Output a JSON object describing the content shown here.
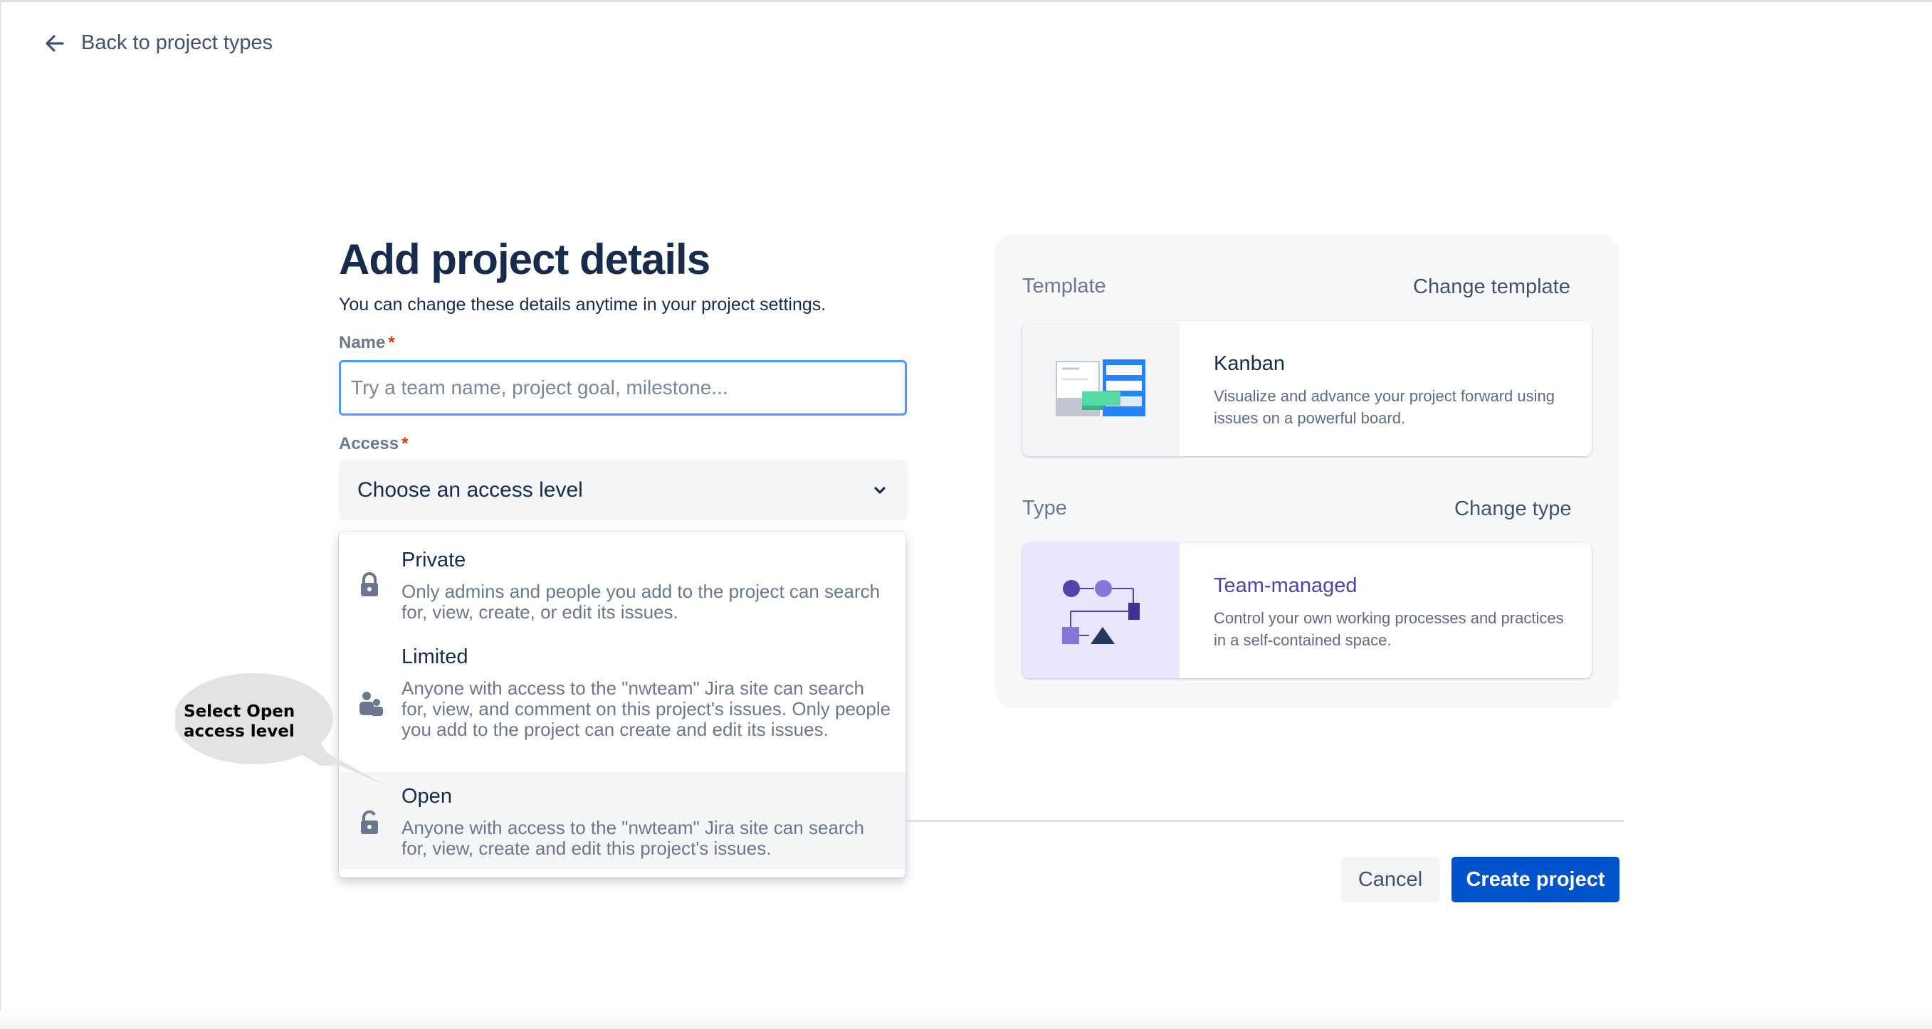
{
  "nav": {
    "back_label": "Back to project types"
  },
  "header": {
    "title": "Add project details",
    "subtitle": "You can change these details anytime in your project settings."
  },
  "form": {
    "name": {
      "label": "Name",
      "required_mark": "*",
      "value": "",
      "placeholder": "Try a team name, project goal, milestone..."
    },
    "access": {
      "label": "Access",
      "required_mark": "*",
      "selected_text": "Choose an access level",
      "options": [
        {
          "title": "Private",
          "description": "Only admins and people you add to the project can search for, view, create, or edit its issues.",
          "icon": "lock-icon"
        },
        {
          "title": "Limited",
          "description": "Anyone with access to the \"nwteam\" Jira site can search for, view, and comment on this project's issues. Only people you add to the project can create and edit its issues.",
          "icon": "people-icon"
        },
        {
          "title": "Open",
          "description": "Anyone with access to the \"nwteam\" Jira site can search for, view, create and edit this project's issues.",
          "icon": "unlock-icon",
          "highlighted": true
        }
      ]
    }
  },
  "callout": {
    "text_line1": "Select Open",
    "text_line2": "access level"
  },
  "template_panel": {
    "template_label": "Template",
    "change_template": "Change template",
    "template_card": {
      "title": "Kanban",
      "description": "Visualize and advance your project forward using issues on a powerful board."
    },
    "type_label": "Type",
    "change_type": "Change type",
    "type_card": {
      "title": "Team-managed",
      "description": "Control your own working processes and practices in a self-contained space."
    }
  },
  "footer": {
    "cancel_label": "Cancel",
    "create_label": "Create project"
  },
  "colors": {
    "primary": "#0052cc",
    "focus_border": "#4c9aff",
    "required": "#de350b",
    "team_managed_title": "#5243aa",
    "type_thumb_bg": "#eae6ff"
  }
}
